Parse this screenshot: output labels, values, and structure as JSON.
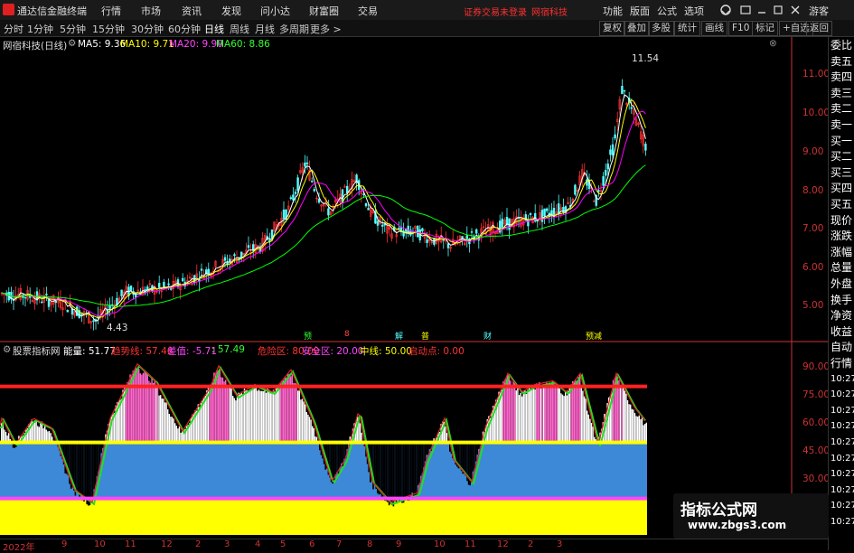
{
  "app": {
    "title": "通达信金融终端"
  },
  "topmenu": [
    {
      "label": "行情"
    },
    {
      "label": "市场"
    },
    {
      "label": "资讯"
    },
    {
      "label": "发现"
    },
    {
      "label": "问小达"
    },
    {
      "label": "财富圈"
    },
    {
      "label": "交易"
    }
  ],
  "warning": {
    "text": "证券交易未登录",
    "stock": "网宿科技"
  },
  "right_menu": [
    {
      "label": "功能"
    },
    {
      "label": "版面"
    },
    {
      "label": "公式"
    },
    {
      "label": "选项"
    },
    {
      "label": "游客"
    }
  ],
  "periods": [
    {
      "label": "分时"
    },
    {
      "label": "1分钟"
    },
    {
      "label": "5分钟"
    },
    {
      "label": "15分钟"
    },
    {
      "label": "30分钟"
    },
    {
      "label": "60分钟"
    },
    {
      "label": "日线",
      "active": true
    },
    {
      "label": "周线"
    },
    {
      "label": "月线"
    },
    {
      "label": "多周期"
    },
    {
      "label": "更多 >"
    }
  ],
  "toolbar": [
    {
      "label": "复权"
    },
    {
      "label": "叠加"
    },
    {
      "label": "多股"
    },
    {
      "label": "统计"
    },
    {
      "label": "画线"
    },
    {
      "label": "F10"
    },
    {
      "label": "标记"
    },
    {
      "label": "+自选"
    },
    {
      "label": "返回"
    }
  ],
  "main_legend": {
    "name": "网宿科技(日线)",
    "ma5": "MA5: 9.36",
    "ma10": "MA10: 9.71",
    "ma20": "MA20: 9.90",
    "ma60": "MA60: 8.86"
  },
  "colors": {
    "ma5": "#ffffff",
    "ma10": "#ffff00",
    "ma20": "#ff00ff",
    "ma60": "#00ff00",
    "up": "#ff3333",
    "down": "#54ffff",
    "axis": "#cc3333"
  },
  "price_axis": [
    "11.00",
    "10.00",
    "9.00",
    "8.00",
    "7.00",
    "6.00",
    "5.00"
  ],
  "price_annotations": {
    "high": "11.54",
    "low": "4.43"
  },
  "event_markers": [
    {
      "label": "预"
    },
    {
      "label": "8"
    },
    {
      "label": "解"
    },
    {
      "label": "普"
    },
    {
      "label": "财"
    },
    {
      "label": "预减"
    }
  ],
  "sub_legend": {
    "name": "股票指标网",
    "energy": "能量: 51.77",
    "trend": "趋势线: 57.46",
    "diff": "差值: -5.71",
    "v3": ": 57.49",
    "danger": "危险区: 80.00",
    "safe": "安全区: 20.00",
    "mid": "中线: 50.00",
    "start": "启动点: 0.00"
  },
  "sub_axis": [
    "90.00",
    "75.00",
    "60.00",
    "45.00",
    "30.00"
  ],
  "time_axis": [
    "2022年",
    "9",
    "10",
    "11",
    "12",
    "2",
    "3",
    "4",
    "5",
    "6",
    "7",
    "8",
    "9",
    "10",
    "11",
    "12",
    "2",
    "3"
  ],
  "right_panel": [
    {
      "label": "委比"
    },
    {
      "label": "卖五"
    },
    {
      "label": "卖四"
    },
    {
      "label": "卖三"
    },
    {
      "label": "卖二"
    },
    {
      "label": "卖一"
    },
    {
      "label": "买一"
    },
    {
      "label": "买二"
    },
    {
      "label": "买三"
    },
    {
      "label": "买四"
    },
    {
      "label": "买五"
    },
    {
      "label": "现价"
    },
    {
      "label": "涨跌"
    },
    {
      "label": "涨幅"
    },
    {
      "label": "总量"
    },
    {
      "label": "外盘"
    },
    {
      "label": "换手"
    },
    {
      "label": "净资"
    },
    {
      "label": "收益"
    },
    {
      "label": "自动"
    },
    {
      "label": "行情"
    },
    {
      "label": "10:27"
    },
    {
      "label": "10:27"
    },
    {
      "label": "10:27"
    },
    {
      "label": "10:27"
    },
    {
      "label": "10:27"
    },
    {
      "label": "10:27"
    },
    {
      "label": "10:27"
    },
    {
      "label": "10:27"
    },
    {
      "label": "10:27"
    },
    {
      "label": "10:27"
    }
  ],
  "watermark": {
    "title": "指标公式网",
    "url": "www.zbgs3.com"
  }
}
